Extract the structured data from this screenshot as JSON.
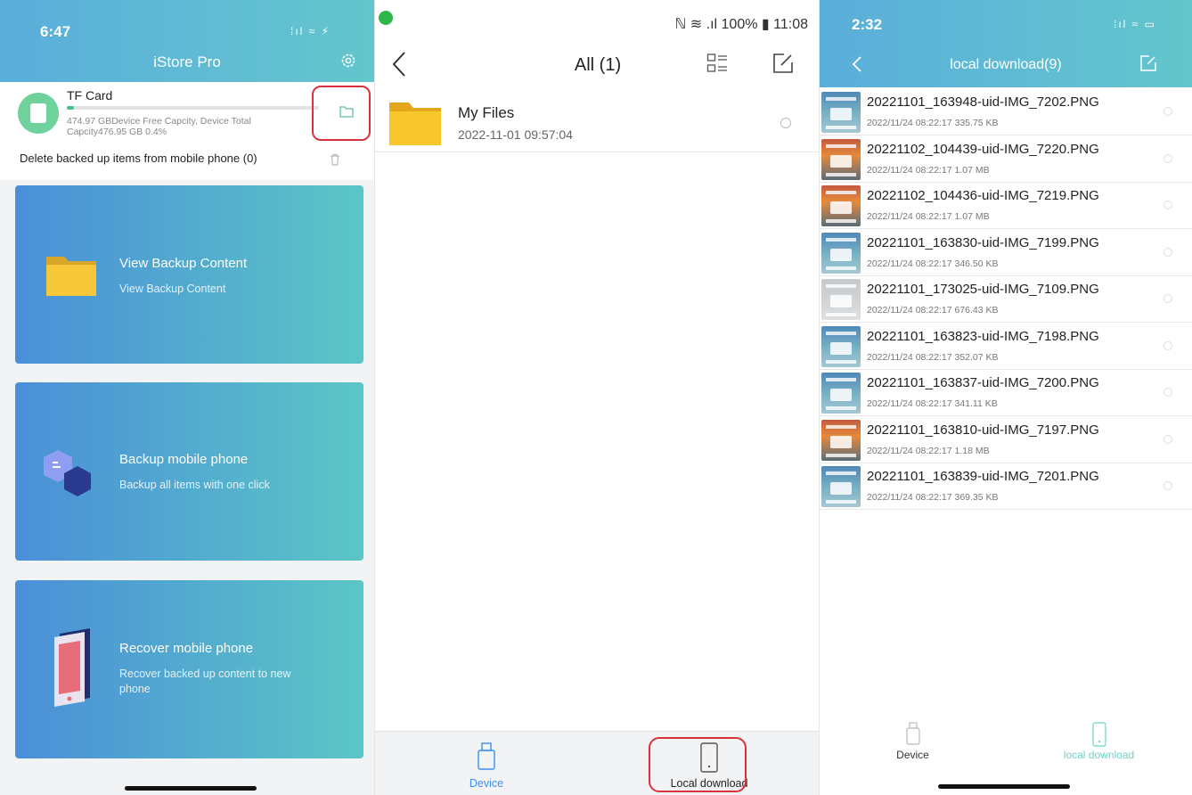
{
  "panel1": {
    "status_time": "6:47",
    "status_icons": "⁞ıl ≈ ⚡",
    "title": "iStore Pro",
    "tf_card": {
      "name": "TF Card",
      "description": "474.97 GBDevice Free Capcity, Device Total Capcity476.95 GB 0.4%",
      "usage_fraction": 0.004
    },
    "delete_label": "Delete backed up items from mobile phone (0)",
    "cards": [
      {
        "title": "View Backup Content",
        "subtitle": "View Backup Content",
        "icon": "folder-icon"
      },
      {
        "title": "Backup mobile phone",
        "subtitle": "Backup all items with one click",
        "icon": "backup-hexagon-icon"
      },
      {
        "title": "Recover mobile phone",
        "subtitle": "Recover backed up content to new phone",
        "icon": "phone-icon"
      }
    ],
    "colors": {
      "header_start": "#5aaedb",
      "header_end": "#63c6cc",
      "card_start": "#4a8fd8",
      "card_end": "#5bc6c6",
      "highlight": "#d9323d"
    }
  },
  "panel2": {
    "status_right": "ℕ ≋ .ıl 100% ▮ 11:08",
    "title": "All (1)",
    "files": [
      {
        "name": "My Files",
        "date": "2022-11-01 09:57:04"
      }
    ],
    "tabs": [
      {
        "label": "Device",
        "icon": "usb-drive-icon",
        "active": true
      },
      {
        "label": "Local download",
        "icon": "phone-icon",
        "active": false
      }
    ],
    "colors": {
      "active_tab": "#3b8ff0",
      "folder": "#f7c52b"
    }
  },
  "panel3": {
    "status_time": "2:32",
    "status_icons": "⁞ıl ≈ ▭",
    "title": "local download(9)",
    "files": [
      {
        "name": "20221101_163948-uid-IMG_7202.PNG",
        "meta": "2022/11/24 08:22:17 335.75 KB",
        "thumb": "a"
      },
      {
        "name": "20221102_104439-uid-IMG_7220.PNG",
        "meta": "2022/11/24 08:22:17 1.07 MB",
        "thumb": "b"
      },
      {
        "name": "20221102_104436-uid-IMG_7219.PNG",
        "meta": "2022/11/24 08:22:17 1.07 MB",
        "thumb": "b"
      },
      {
        "name": "20221101_163830-uid-IMG_7199.PNG",
        "meta": "2022/11/24 08:22:17 346.50 KB",
        "thumb": "a"
      },
      {
        "name": "20221101_173025-uid-IMG_7109.PNG",
        "meta": "2022/11/24 08:22:17 676.43 KB",
        "thumb": "c"
      },
      {
        "name": "20221101_163823-uid-IMG_7198.PNG",
        "meta": "2022/11/24 08:22:17 352.07 KB",
        "thumb": "a"
      },
      {
        "name": "20221101_163837-uid-IMG_7200.PNG",
        "meta": "2022/11/24 08:22:17 341.11 KB",
        "thumb": "a"
      },
      {
        "name": "20221101_163810-uid-IMG_7197.PNG",
        "meta": "2022/11/24 08:22:17 1.18 MB",
        "thumb": "b"
      },
      {
        "name": "20221101_163839-uid-IMG_7201.PNG",
        "meta": "2022/11/24 08:22:17 369.35 KB",
        "thumb": "a"
      }
    ],
    "tabs": [
      {
        "label": "Device",
        "icon": "usb-drive-icon",
        "active": false
      },
      {
        "label": "local download",
        "icon": "phone-icon",
        "active": true
      }
    ],
    "colors": {
      "active_tab": "#6fd4c2"
    }
  }
}
